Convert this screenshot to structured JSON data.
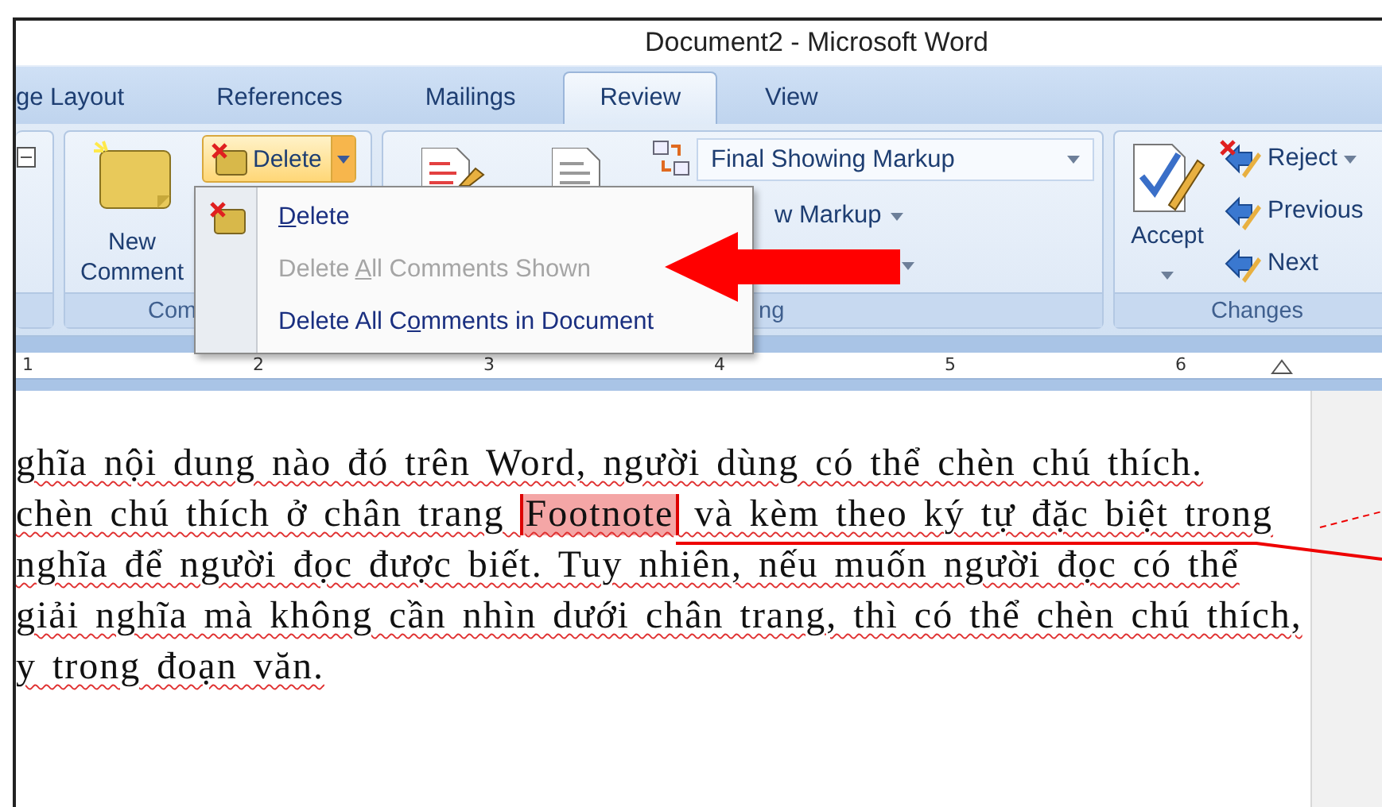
{
  "window": {
    "title": "Document2 - Microsoft Word"
  },
  "tabs": [
    {
      "label": "ge Layout",
      "selected": false
    },
    {
      "label": "References",
      "selected": false
    },
    {
      "label": "Mailings",
      "selected": false
    },
    {
      "label": "Review",
      "selected": true
    },
    {
      "label": "View",
      "selected": false
    }
  ],
  "ribbon": {
    "groups": [
      {
        "kind": "partial"
      },
      {
        "kind": "comments",
        "title": "Com",
        "new_comment": "New Comment",
        "delete": "Delete"
      },
      {
        "kind": "tracking",
        "title": "ng",
        "markup_select": "Final Showing Markup",
        "show_markup": "w Markup"
      },
      {
        "kind": "changes",
        "title": "Changes",
        "accept": "Accept",
        "reject": "Reject",
        "previous": "Previous",
        "next": "Next"
      }
    ]
  },
  "delete_menu": {
    "items": [
      {
        "label_parts": {
          "key": "D",
          "after": "elete"
        },
        "disabled": false
      },
      {
        "label_parts": {
          "before": "Delete ",
          "key": "A",
          "after": "ll Comments Shown"
        },
        "disabled": true
      },
      {
        "label_parts": {
          "before": "Delete All C",
          "key": "o",
          "after": "mments in Document"
        },
        "disabled": false
      }
    ]
  },
  "ruler": {
    "marks": [
      "1",
      "2",
      "3",
      "4",
      "5",
      "6"
    ]
  },
  "document": {
    "lines": [
      {
        "segments": [
          {
            "text": "ghĩa nội dung nào đó trên Word, người dùng có thể chèn chú thích.",
            "commented": false
          }
        ]
      },
      {
        "segments": [
          {
            "text": "chèn chú thích ở chân trang ",
            "commented": false
          },
          {
            "text": "Footnote",
            "commented": true
          },
          {
            "text": " và kèm theo ký tự đặc biệt trong",
            "commented": false
          }
        ]
      },
      {
        "segments": [
          {
            "text": "nghĩa để người đọc được biết. Tuy nhiên, nếu muốn người đọc có thể",
            "commented": false
          }
        ]
      },
      {
        "segments": [
          {
            "text": "giải nghĩa mà không cần nhìn dưới chân trang, thì có thể chèn chú thích,",
            "commented": false
          }
        ]
      },
      {
        "segments": [
          {
            "text": "y trong đoạn văn.",
            "commented": false
          }
        ]
      }
    ]
  }
}
